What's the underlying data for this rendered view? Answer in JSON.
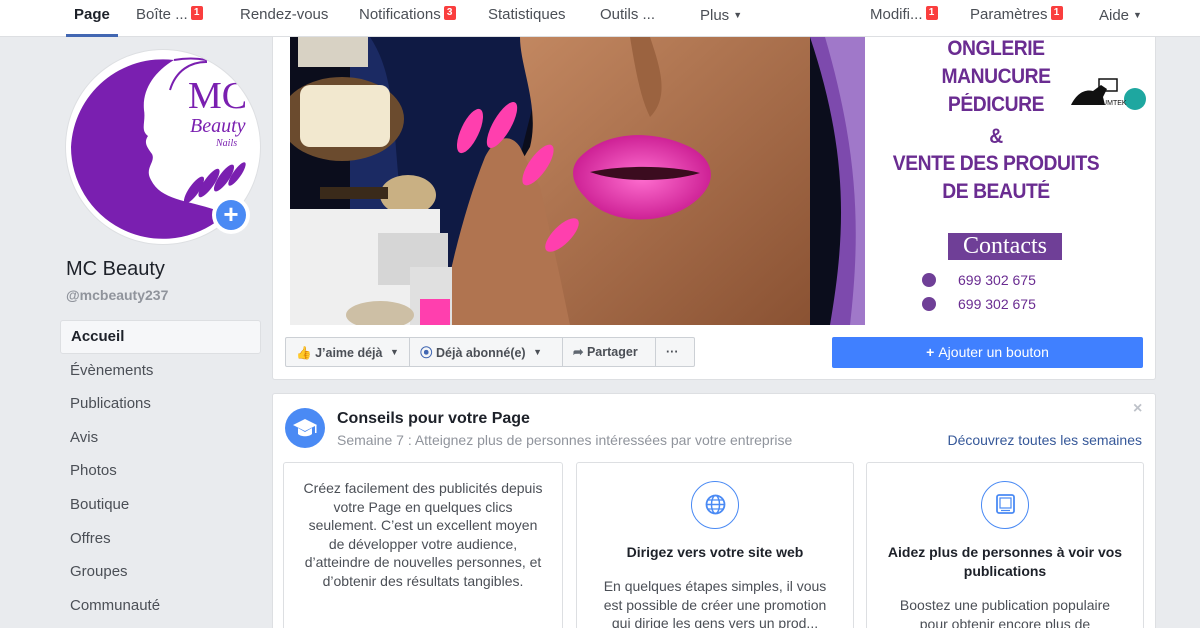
{
  "nav": {
    "page": "Page",
    "inbox": "Boîte ...",
    "inbox_badge": "1",
    "appointments": "Rendez-vous",
    "notifications": "Notifications",
    "notifications_badge": "3",
    "statistics": "Statistiques",
    "tools": "Outils ...",
    "more": "Plus",
    "edit": "Modifi...",
    "edit_badge": "1",
    "settings": "Paramètres",
    "settings_badge": "1",
    "help": "Aide"
  },
  "profile": {
    "logo_initials": "MC",
    "logo_script": "Beauty",
    "logo_sub": "Nails",
    "name": "MC Beauty",
    "handle": "@mcbeauty237"
  },
  "sidebar": {
    "items": [
      {
        "label": "Accueil"
      },
      {
        "label": "Évènements"
      },
      {
        "label": "Publications"
      },
      {
        "label": "Avis"
      },
      {
        "label": "Photos"
      },
      {
        "label": "Boutique"
      },
      {
        "label": "Offres"
      },
      {
        "label": "Groupes"
      },
      {
        "label": "Communauté"
      }
    ]
  },
  "cover": {
    "lines": [
      "ONGLERIE",
      "MANUCURE",
      "PÉDICURE",
      "&",
      "VENTE DES PRODUITS",
      "DE BEAUTÉ"
    ],
    "partner_logo": "NUMTEK",
    "contacts": "Contacts",
    "phone1": "699 302 675",
    "phone2": "699 302 675"
  },
  "actions": {
    "like": "J’aime déjà",
    "follow": "Déjà abonné(e)",
    "share": "Partager",
    "more": "···",
    "add_button": "Ajouter un bouton"
  },
  "tips": {
    "title": "Conseils pour votre Page",
    "subtitle": "Semaine 7 : Atteignez plus de personnes intéressées par votre entreprise",
    "link": "Découvrez toutes les semaines",
    "close": "×",
    "cards": [
      {
        "text": "Créez facilement des publicités depuis votre Page en quelques clics seulement. C’est un excellent moyen de développer votre audience, d’atteindre de nouvelles personnes, et d’obtenir des résultats tangibles."
      },
      {
        "title": "Dirigez vers votre site web",
        "text": "En quelques étapes simples, il vous est possible de créer une promotion qui dirige les gens vers un prod..."
      },
      {
        "title": "Aidez plus de personnes à voir vos publications",
        "text": "Boostez une publication populaire pour obtenir encore plus de"
      }
    ]
  },
  "colors": {
    "brand_purple": "#6a2c91",
    "facebook_blue": "#4267b2",
    "button_blue": "#4080ff",
    "badge_red": "#fa3e3e"
  }
}
